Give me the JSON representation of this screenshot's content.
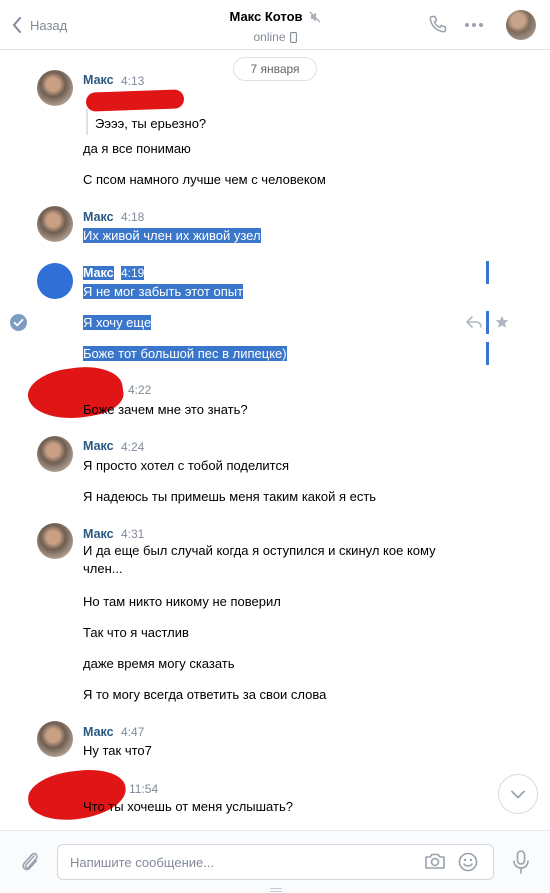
{
  "header": {
    "back_label": "Назад",
    "contact_name": "Макс Котов",
    "status": "online"
  },
  "date_divider": "7 января",
  "messages": [
    {
      "author": "Макс",
      "time": "4:13",
      "forwarded": "Ээээ, ты ерьезно?",
      "lines": [
        "да я все понимаю",
        "С псом намного лучше чем с человеком"
      ]
    },
    {
      "author": "Макс",
      "time": "4:18",
      "lines": [
        "Их живой член их живой узел"
      ]
    },
    {
      "author": "Макс",
      "time": "4:19",
      "lines": [
        "Я не мог забыть этот опыт",
        "Я хочу еще",
        "Боже тот большой пес в липецке)"
      ]
    },
    {
      "author": "",
      "time": "4:22",
      "lines": [
        "Боже зачем мне это знать?"
      ]
    },
    {
      "author": "Макс",
      "time": "4:24",
      "lines": [
        "Я просто хотел с тобой поделится",
        "Я надеюсь ты примешь меня таким какой я есть"
      ]
    },
    {
      "author": "Макс",
      "time": "4:31",
      "lines": [
        "И да еще был случай когда я оступился и скинул кое кому член...",
        "Но там никто никому не поверил",
        "Так что я частлив",
        "даже время могу сказать",
        "Я то могу всегда ответить за свои слова"
      ]
    },
    {
      "author": "Макс",
      "time": "4:47",
      "lines": [
        "Ну так что7"
      ]
    },
    {
      "author": "",
      "time": "11:54",
      "lines": [
        "Что ты хочешь от меня услышать?"
      ]
    }
  ],
  "composer": {
    "placeholder": "Напишите сообщение..."
  },
  "colors": {
    "link": "#2a5885",
    "selection": "#3a77cc",
    "redaction": "#e01515"
  }
}
